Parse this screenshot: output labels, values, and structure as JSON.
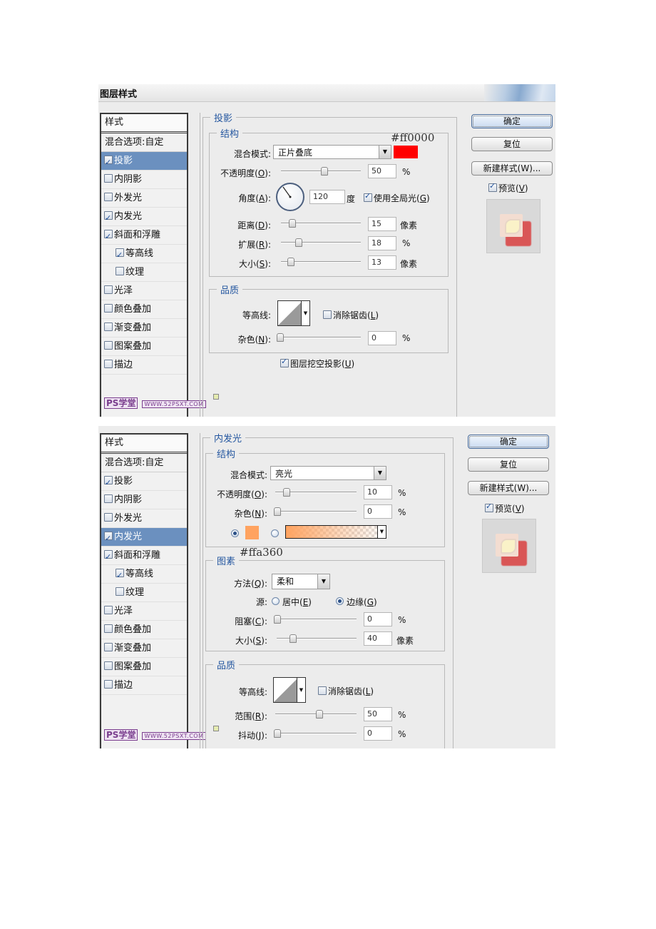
{
  "dialog1": {
    "title": "图层样式",
    "sidebar": {
      "header": "样式",
      "blend_options": "混合选项:自定",
      "items": [
        {
          "label": "投影",
          "checked": true,
          "selected": true,
          "sub": false
        },
        {
          "label": "内阴影",
          "checked": false,
          "selected": false,
          "sub": false
        },
        {
          "label": "外发光",
          "checked": false,
          "selected": false,
          "sub": false
        },
        {
          "label": "内发光",
          "checked": true,
          "selected": false,
          "sub": false
        },
        {
          "label": "斜面和浮雕",
          "checked": true,
          "selected": false,
          "sub": false
        },
        {
          "label": "等高线",
          "checked": true,
          "selected": false,
          "sub": true
        },
        {
          "label": "纹理",
          "checked": false,
          "selected": false,
          "sub": true
        },
        {
          "label": "光泽",
          "checked": false,
          "selected": false,
          "sub": false
        },
        {
          "label": "颜色叠加",
          "checked": false,
          "selected": false,
          "sub": false
        },
        {
          "label": "渐变叠加",
          "checked": false,
          "selected": false,
          "sub": false
        },
        {
          "label": "图案叠加",
          "checked": false,
          "selected": false,
          "sub": false
        },
        {
          "label": "描边",
          "checked": false,
          "selected": false,
          "sub": false
        }
      ],
      "logo_text": "PS学堂",
      "logo_url": "WWW.52PSXT.COM"
    },
    "panel_title": "投影",
    "structure": {
      "legend": "结构",
      "hex_note": "#ff0000",
      "blend_mode_label": "混合模式:",
      "blend_mode_value": "正片叠底",
      "color": "#ff0000",
      "opacity_label": "不透明度(",
      "opacity_key": "O",
      "opacity_value": "50",
      "opacity_pct": 50,
      "opacity_unit": "%",
      "angle_label": "角度(",
      "angle_key": "A",
      "angle_value": "120",
      "angle_unit": "度",
      "global_light_label": "使用全局光(",
      "global_light_key": "G",
      "global_light_checked": true,
      "distance_label": "距离(",
      "distance_key": "D",
      "distance_value": "15",
      "distance_pct": 10,
      "distance_unit": "像素",
      "spread_label": "扩展(",
      "spread_key": "R",
      "spread_value": "18",
      "spread_pct": 18,
      "spread_unit": "%",
      "size_label": "大小(",
      "size_key": "S",
      "size_value": "13",
      "size_pct": 8,
      "size_unit": "像素"
    },
    "quality": {
      "legend": "品质",
      "contour_label": "等高线:",
      "antialias_label": "消除锯齿(",
      "antialias_key": "L",
      "antialias_checked": false,
      "noise_label": "杂色(",
      "noise_key": "N",
      "noise_value": "0",
      "noise_pct": 0,
      "noise_unit": "%"
    },
    "knockout_label": "图层挖空投影(",
    "knockout_key": "U",
    "knockout_checked": true,
    "buttons": {
      "ok": "确定",
      "reset": "复位",
      "new_style": "新建样式(W)...",
      "preview_label": "预览(",
      "preview_key": "V",
      "preview_checked": true
    }
  },
  "dialog2": {
    "sidebar": {
      "header": "样式",
      "blend_options": "混合选项:自定",
      "items": [
        {
          "label": "投影",
          "checked": true,
          "selected": false,
          "sub": false
        },
        {
          "label": "内阴影",
          "checked": false,
          "selected": false,
          "sub": false
        },
        {
          "label": "外发光",
          "checked": false,
          "selected": false,
          "sub": false
        },
        {
          "label": "内发光",
          "checked": true,
          "selected": true,
          "sub": false
        },
        {
          "label": "斜面和浮雕",
          "checked": true,
          "selected": false,
          "sub": false
        },
        {
          "label": "等高线",
          "checked": true,
          "selected": false,
          "sub": true
        },
        {
          "label": "纹理",
          "checked": false,
          "selected": false,
          "sub": true
        },
        {
          "label": "光泽",
          "checked": false,
          "selected": false,
          "sub": false
        },
        {
          "label": "颜色叠加",
          "checked": false,
          "selected": false,
          "sub": false
        },
        {
          "label": "渐变叠加",
          "checked": false,
          "selected": false,
          "sub": false
        },
        {
          "label": "图案叠加",
          "checked": false,
          "selected": false,
          "sub": false
        },
        {
          "label": "描边",
          "checked": false,
          "selected": false,
          "sub": false
        }
      ],
      "logo_text": "PS学堂",
      "logo_url": "WWW.52PSXT.COM"
    },
    "panel_title": "内发光",
    "structure": {
      "legend": "结构",
      "blend_mode_label": "混合模式:",
      "blend_mode_value": "亮光",
      "opacity_label": "不透明度(",
      "opacity_key": "O",
      "opacity_value": "10",
      "opacity_pct": 10,
      "opacity_unit": "%",
      "noise_label": "杂色(",
      "noise_key": "N",
      "noise_value": "0",
      "noise_pct": 0,
      "noise_unit": "%",
      "color": "#ffa360",
      "color_radio_selected": true,
      "gradient_radio_selected": false,
      "hex_note": "#ffa360"
    },
    "elements": {
      "legend": "图素",
      "technique_label": "方法(",
      "technique_key": "Q",
      "technique_value": "柔和",
      "source_label": "源:",
      "source_center_label": "居中(",
      "source_center_key": "E",
      "source_center_selected": false,
      "source_edge_label": "边缘(",
      "source_edge_key": "G",
      "source_edge_selected": true,
      "choke_label": "阻塞(",
      "choke_key": "C",
      "choke_value": "0",
      "choke_pct": 0,
      "choke_unit": "%",
      "size_label": "大小(",
      "size_key": "S",
      "size_value": "40",
      "size_pct": 16,
      "size_unit": "像素"
    },
    "quality": {
      "legend": "品质",
      "contour_label": "等高线:",
      "antialias_label": "消除锯齿(",
      "antialias_key": "L",
      "antialias_checked": false,
      "range_label": "范围(",
      "range_key": "R",
      "range_value": "50",
      "range_pct": 50,
      "range_unit": "%",
      "jitter_label": "抖动(",
      "jitter_key": "J",
      "jitter_value": "0",
      "jitter_pct": 0,
      "jitter_unit": "%"
    },
    "buttons": {
      "ok": "确定",
      "reset": "复位",
      "new_style": "新建样式(W)...",
      "preview_label": "预览(",
      "preview_key": "V",
      "preview_checked": true
    }
  }
}
